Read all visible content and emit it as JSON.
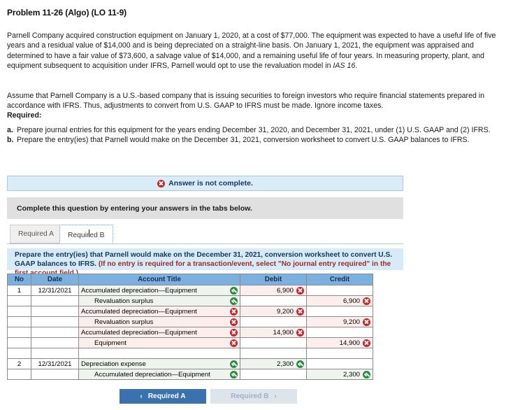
{
  "problem": {
    "title": "Problem 11-26 (Algo) (LO 11-9)",
    "scenario": "Parnell Company acquired construction equipment on January 1, 2020, at a cost of $77,000. The equipment was expected to have a useful life of five years and a residual value of $14,000 and is being depreciated on a straight-line basis. On January 1, 2021, the equipment was appraised and determined to have a fair value of $73,600, a salvage value of $14,000, and a remaining useful life of four years. In measuring property, plant, and equipment subsequent to acquisition under IFRS, Parnell would opt to use the revaluation model in ",
    "scenario_italic": "IAS 16",
    "scenario_tail": ".",
    "assumption": "Assume that Parnell Company is a U.S.-based company that is issuing securities to foreign investors who require financial statements prepared in accordance with IFRS. Thus, adjustments to convert from U.S. GAAP to IFRS must be made. Ignore income taxes.",
    "required_label": "Required:",
    "requirements": [
      {
        "marker": "a.",
        "text": "Prepare journal entries for this equipment for the years ending December 31, 2020, and December 31, 2021, under (1) U.S. GAAP and (2) IFRS."
      },
      {
        "marker": "b.",
        "text": "Prepare the entry(ies) that Parnell would make on the December 31, 2021, conversion worksheet to convert U.S. GAAP balances to IFRS."
      }
    ]
  },
  "alert": {
    "text": "Answer is not complete.",
    "icon": "error-x-circle-icon",
    "background": "#d9ecf8",
    "border": "#a8cbe0"
  },
  "gray_strip": {
    "text": "Complete this question by entering your answers in the tabs below."
  },
  "tabs": [
    {
      "label": "Required A",
      "active": false
    },
    {
      "label": "Required B",
      "active": true
    }
  ],
  "instruction": {
    "line1": "Prepare the entry(ies) that Parnell would make on the December 31, 2021, conversion worksheet to convert U.S. GAAP",
    "line2_black": "balances to IFRS. ",
    "line2_red": "(If no entry is required for a transaction/event, select \"No journal entry required\" in the first account field.)"
  },
  "table": {
    "headers": [
      "No",
      "Date",
      "Account Title",
      "Debit",
      "Credit"
    ],
    "rows": [
      {
        "no": "1",
        "date": "12/31/2021",
        "account": "Accumulated depreciation—Equipment",
        "indent": false,
        "account_mark": "good",
        "debit": "6,900",
        "debit_mark": "bad",
        "credit": "",
        "credit_mark": ""
      },
      {
        "no": "",
        "date": "",
        "account": "Revaluation surplus",
        "indent": true,
        "account_mark": "good",
        "debit": "",
        "debit_mark": "",
        "credit": "6,900",
        "credit_mark": "bad"
      },
      {
        "no": "",
        "date": "",
        "account": "Accumulated depreciation—Equipment",
        "indent": false,
        "account_mark": "bad",
        "debit": "9,200",
        "debit_mark": "bad",
        "credit": "",
        "credit_mark": ""
      },
      {
        "no": "",
        "date": "",
        "account": "Revaluation surplus",
        "indent": true,
        "account_mark": "bad",
        "debit": "",
        "debit_mark": "",
        "credit": "9,200",
        "credit_mark": "bad"
      },
      {
        "no": "",
        "date": "",
        "account": "Accumulated depreciation—Equipment",
        "indent": false,
        "account_mark": "bad",
        "debit": "14,900",
        "debit_mark": "bad",
        "credit": "",
        "credit_mark": ""
      },
      {
        "no": "",
        "date": "",
        "account": "Equipment",
        "indent": true,
        "account_mark": "bad",
        "debit": "",
        "debit_mark": "",
        "credit": "14,900",
        "credit_mark": "bad"
      },
      {
        "no": "",
        "date": "",
        "account": "",
        "indent": false,
        "account_mark": "",
        "debit": "",
        "debit_mark": "",
        "credit": "",
        "credit_mark": ""
      },
      {
        "no": "2",
        "date": "12/31/2021",
        "account": "Depreciation expense",
        "indent": false,
        "account_mark": "good",
        "debit": "2,300",
        "debit_mark": "good",
        "credit": "",
        "credit_mark": ""
      },
      {
        "no": "",
        "date": "",
        "account": "Accumulated depreciation—Equipment",
        "indent": true,
        "account_mark": "good",
        "debit": "",
        "debit_mark": "",
        "credit": "2,300",
        "credit_mark": "good"
      }
    ]
  },
  "nav": {
    "prev_label": "Required A",
    "prev_chevron": "‹",
    "next_label": "Required B",
    "next_chevron": "›"
  },
  "colors": {
    "header_blue": "#7cb0e0",
    "banner_blue": "#d6eaf8",
    "primary_button": "#3a72b0",
    "muted_button": "#dde4ec",
    "good_green": "#2d8a3e",
    "bad_red": "#c9262a"
  }
}
